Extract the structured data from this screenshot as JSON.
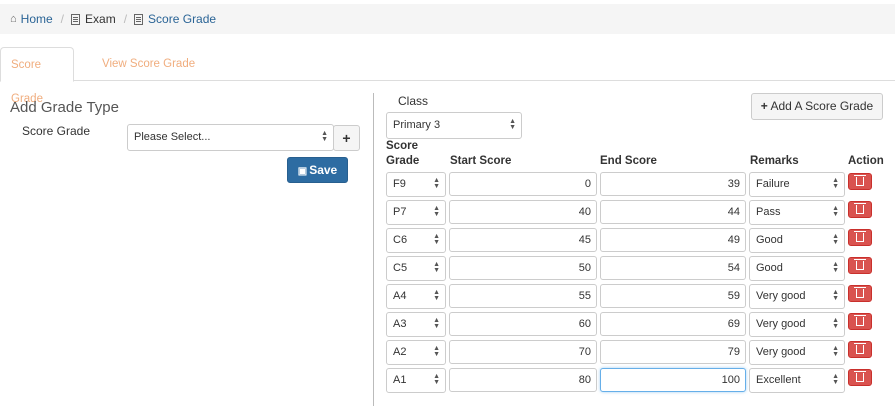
{
  "breadcrumb": {
    "home": "Home",
    "exam": "Exam",
    "current": "Score Grade"
  },
  "tabs": [
    "Score Grade",
    "View Score Grade"
  ],
  "left": {
    "title": "Add Grade Type",
    "field_label": "Score Grade",
    "select_value": "Please Select...",
    "plus": "+",
    "save": "Save"
  },
  "right": {
    "class_label": "Class",
    "class_value": "Primary 3",
    "add_button": "Add A Score Grade",
    "headers": {
      "grade_1": "Score",
      "grade_2": "Grade",
      "start": "Start Score",
      "end": "End Score",
      "remarks": "Remarks",
      "action": "Action"
    }
  },
  "rows": [
    {
      "grade": "F9",
      "start": "0",
      "end": "39",
      "remark": "Failure"
    },
    {
      "grade": "P7",
      "start": "40",
      "end": "44",
      "remark": "Pass"
    },
    {
      "grade": "C6",
      "start": "45",
      "end": "49",
      "remark": "Good"
    },
    {
      "grade": "C5",
      "start": "50",
      "end": "54",
      "remark": "Good"
    },
    {
      "grade": "A4",
      "start": "55",
      "end": "59",
      "remark": "Very good"
    },
    {
      "grade": "A3",
      "start": "60",
      "end": "69",
      "remark": "Very good"
    },
    {
      "grade": "A2",
      "start": "70",
      "end": "79",
      "remark": "Very good"
    },
    {
      "grade": "A1",
      "start": "80",
      "end": "100",
      "remark": "Excellent"
    }
  ]
}
